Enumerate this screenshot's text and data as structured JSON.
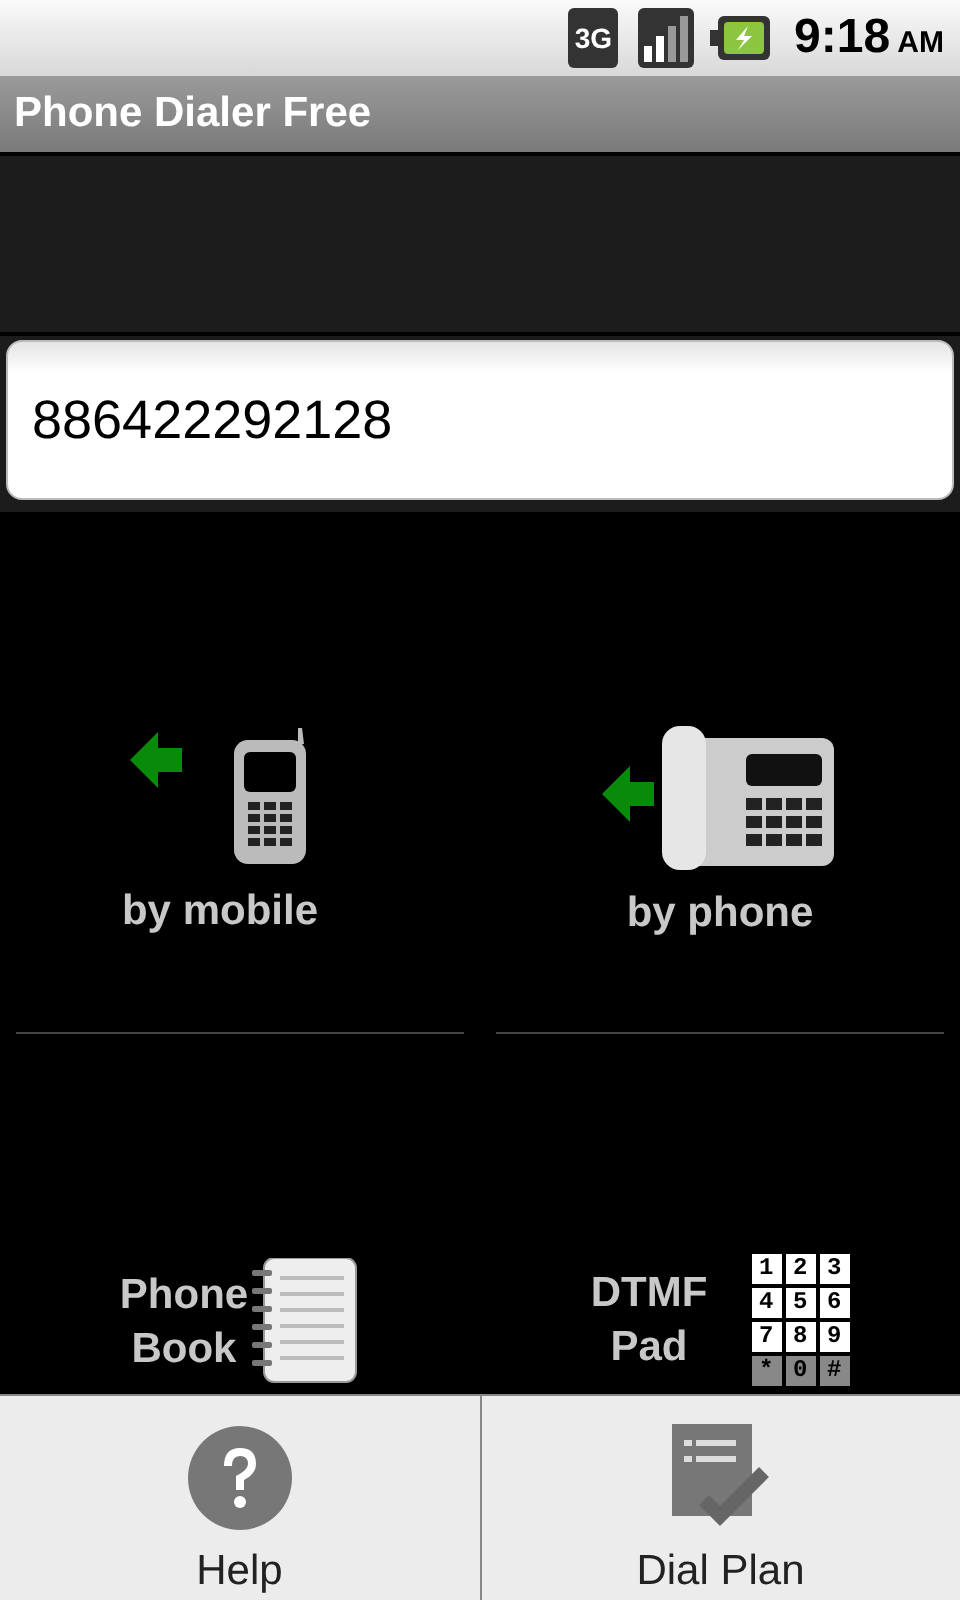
{
  "status_bar": {
    "network": "3G",
    "time": "9:18",
    "meridiem": "AM"
  },
  "window": {
    "title": "Phone Dialer Free"
  },
  "number_field": {
    "value": "886422292128"
  },
  "actions": [
    {
      "kind": "mobile",
      "label": "by mobile"
    },
    {
      "kind": "desk",
      "label": "by phone"
    },
    {
      "kind": "book",
      "label": "Phone\nBook"
    },
    {
      "kind": "keypad",
      "label": "DTMF\nPad",
      "keys": [
        "1",
        "2",
        "3",
        "4",
        "5",
        "6",
        "7",
        "8",
        "9",
        "*",
        "0",
        "#"
      ]
    }
  ],
  "menu": [
    {
      "kind": "help",
      "label": "Help"
    },
    {
      "kind": "plan",
      "label": "Dial Plan"
    }
  ]
}
